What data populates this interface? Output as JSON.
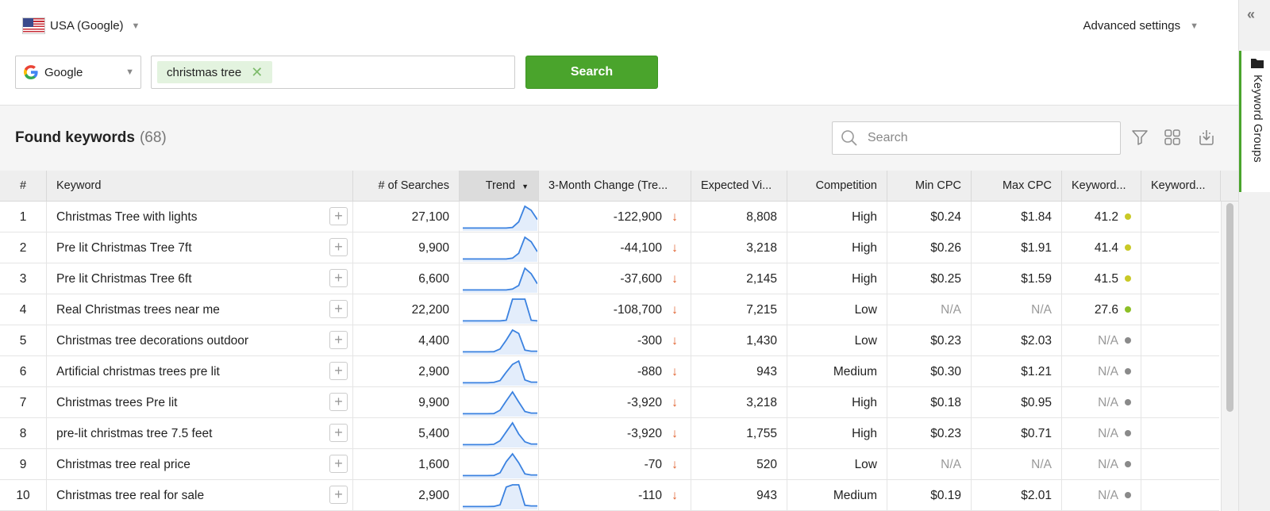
{
  "locale": {
    "flag_icon": "us-flag-icon",
    "label": "USA (Google)"
  },
  "advanced_settings": {
    "label": "Advanced settings"
  },
  "search_engine": {
    "label": "Google",
    "icon": "google-icon"
  },
  "keyword_input": {
    "chips": [
      "christmas tree"
    ]
  },
  "search_button": {
    "label": "Search"
  },
  "found": {
    "title": "Found keywords",
    "count": "(68)"
  },
  "table_search": {
    "placeholder": "Search"
  },
  "toolbar": {
    "icons": [
      "filter-icon",
      "grid-view-icon",
      "export-icon"
    ]
  },
  "table": {
    "columns": [
      "#",
      "Keyword",
      "# of Searches",
      "Trend",
      "3-Month Change (Tre...",
      "Expected Vi...",
      "Competition",
      "Min CPC",
      "Max CPC",
      "Keyword...",
      "Keyword..."
    ],
    "sorted_column": "Trend",
    "rows": [
      {
        "n": "1",
        "keyword": "Christmas Tree with lights",
        "searches": "27,100",
        "change": "-122,900",
        "visits": "8,808",
        "competition": "High",
        "min_cpc": "$0.24",
        "max_cpc": "$1.84",
        "kd": "41.2",
        "kd_color": "#c9c926",
        "trend": [
          0.02,
          0.02,
          0.02,
          0.02,
          0.02,
          0.02,
          0.02,
          0.02,
          0.05,
          0.3,
          1.0,
          0.82,
          0.4
        ]
      },
      {
        "n": "2",
        "keyword": "Pre lit Christmas Tree 7ft",
        "searches": "9,900",
        "change": "-44,100",
        "visits": "3,218",
        "competition": "High",
        "min_cpc": "$0.26",
        "max_cpc": "$1.91",
        "kd": "41.4",
        "kd_color": "#c9c926",
        "trend": [
          0.02,
          0.02,
          0.02,
          0.02,
          0.02,
          0.02,
          0.02,
          0.02,
          0.06,
          0.28,
          1.0,
          0.8,
          0.35
        ]
      },
      {
        "n": "3",
        "keyword": "Pre lit Christmas Tree 6ft",
        "searches": "6,600",
        "change": "-37,600",
        "visits": "2,145",
        "competition": "High",
        "min_cpc": "$0.25",
        "max_cpc": "$1.59",
        "kd": "41.5",
        "kd_color": "#c9c926",
        "trend": [
          0.02,
          0.02,
          0.02,
          0.02,
          0.02,
          0.02,
          0.02,
          0.02,
          0.06,
          0.22,
          1.0,
          0.75,
          0.3
        ]
      },
      {
        "n": "4",
        "keyword": "Real Christmas trees near me",
        "searches": "22,200",
        "change": "-108,700",
        "visits": "7,215",
        "competition": "Low",
        "min_cpc": "N/A",
        "max_cpc": "N/A",
        "kd": "27.6",
        "kd_color": "#8cbf26",
        "trend": [
          0.02,
          0.02,
          0.02,
          0.02,
          0.02,
          0.02,
          0.02,
          0.05,
          1.0,
          1.0,
          1.0,
          0.05,
          0.02
        ]
      },
      {
        "n": "5",
        "keyword": "Christmas tree decorations outdoor",
        "searches": "4,400",
        "change": "-300",
        "visits": "1,430",
        "competition": "Low",
        "min_cpc": "$0.23",
        "max_cpc": "$2.03",
        "kd": "N/A",
        "kd_color": "#8a8a8a",
        "trend": [
          0.02,
          0.02,
          0.02,
          0.02,
          0.02,
          0.03,
          0.15,
          0.55,
          1.0,
          0.85,
          0.1,
          0.05,
          0.05
        ]
      },
      {
        "n": "6",
        "keyword": "Artificial christmas trees pre lit",
        "searches": "2,900",
        "change": "-880",
        "visits": "943",
        "competition": "Medium",
        "min_cpc": "$0.30",
        "max_cpc": "$1.21",
        "kd": "N/A",
        "kd_color": "#8a8a8a",
        "trend": [
          0.02,
          0.02,
          0.02,
          0.02,
          0.02,
          0.04,
          0.12,
          0.5,
          0.85,
          1.0,
          0.15,
          0.05,
          0.05
        ]
      },
      {
        "n": "7",
        "keyword": "Christmas trees Pre lit",
        "searches": "9,900",
        "change": "-3,920",
        "visits": "3,218",
        "competition": "High",
        "min_cpc": "$0.18",
        "max_cpc": "$0.95",
        "kd": "N/A",
        "kd_color": "#8a8a8a",
        "trend": [
          0.02,
          0.02,
          0.02,
          0.02,
          0.02,
          0.03,
          0.18,
          0.6,
          1.0,
          0.55,
          0.12,
          0.05,
          0.05
        ]
      },
      {
        "n": "8",
        "keyword": "pre-lit christmas tree 7.5 feet",
        "searches": "5,400",
        "change": "-3,920",
        "visits": "1,755",
        "competition": "High",
        "min_cpc": "$0.23",
        "max_cpc": "$0.71",
        "kd": "N/A",
        "kd_color": "#8a8a8a",
        "trend": [
          0.02,
          0.02,
          0.02,
          0.02,
          0.02,
          0.04,
          0.2,
          0.6,
          1.0,
          0.5,
          0.15,
          0.05,
          0.05
        ]
      },
      {
        "n": "9",
        "keyword": "Christmas tree real price",
        "searches": "1,600",
        "change": "-70",
        "visits": "520",
        "competition": "Low",
        "min_cpc": "N/A",
        "max_cpc": "N/A",
        "kd": "N/A",
        "kd_color": "#8a8a8a",
        "trend": [
          0.02,
          0.02,
          0.02,
          0.02,
          0.02,
          0.03,
          0.15,
          0.65,
          1.0,
          0.6,
          0.1,
          0.05,
          0.05
        ]
      },
      {
        "n": "10",
        "keyword": "Christmas tree real for sale",
        "searches": "2,900",
        "change": "-110",
        "visits": "943",
        "competition": "Medium",
        "min_cpc": "$0.19",
        "max_cpc": "$2.01",
        "kd": "N/A",
        "kd_color": "#8a8a8a",
        "trend": [
          0.02,
          0.02,
          0.02,
          0.02,
          0.02,
          0.03,
          0.1,
          0.9,
          1.0,
          1.0,
          0.08,
          0.05,
          0.05
        ]
      }
    ]
  },
  "right_rail": {
    "collapse_icon": "double-chevron-left-icon",
    "tab_label": "Keyword Groups",
    "tab_icon": "folder-icon"
  }
}
